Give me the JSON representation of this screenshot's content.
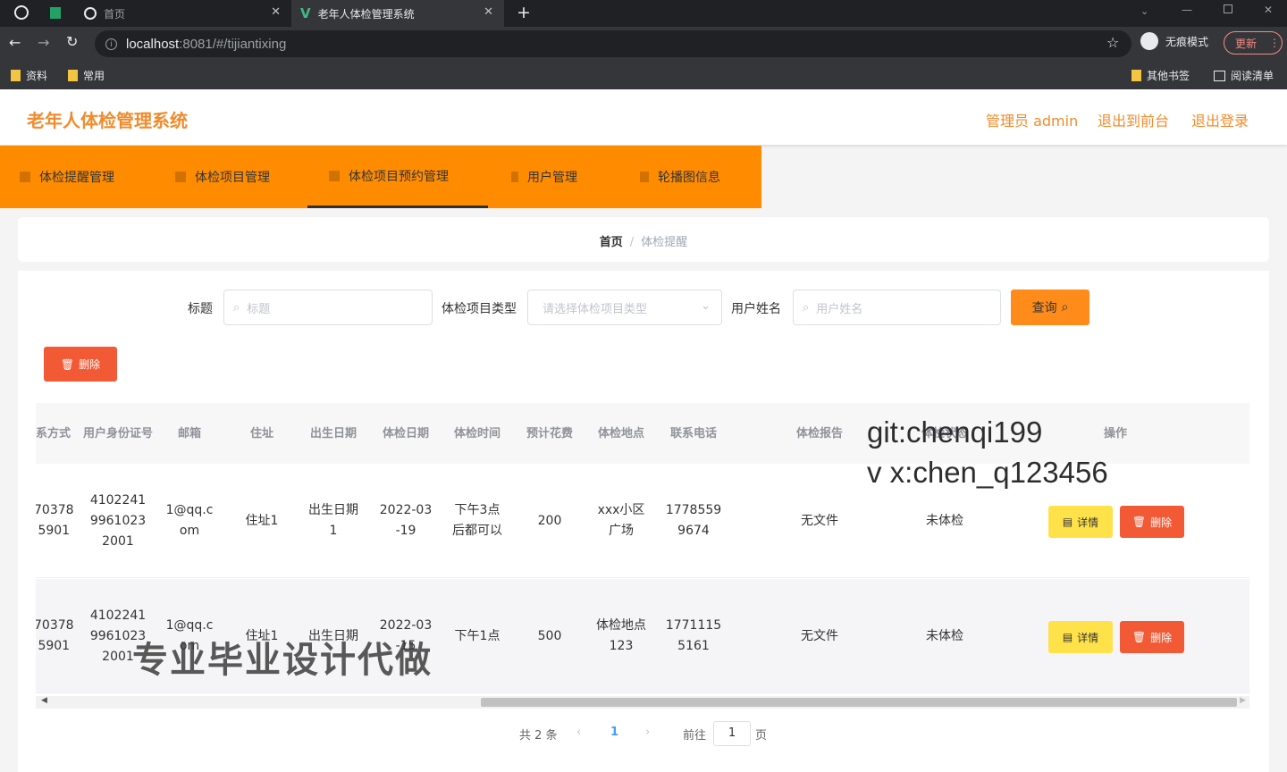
{
  "browser": {
    "tabs": [
      {
        "label": "首页"
      },
      {
        "label": "老年人体检管理系统"
      }
    ],
    "url_host": "localhost",
    "url_path": ":8081/#/tijiantixing",
    "incognito_label": "无痕模式",
    "update_label": "更新",
    "bookmarks": [
      "资料",
      "常用"
    ],
    "other_bookmarks": "其他书签",
    "reading_list": "阅读清单"
  },
  "header": {
    "title": "老年人体检管理系统",
    "admin_label": "管理员 admin",
    "back_label": "退出到前台",
    "logout_label": "退出登录"
  },
  "nav": {
    "items": [
      {
        "label": "体检提醒管理"
      },
      {
        "label": "体检项目管理"
      },
      {
        "label": "体检项目预约管理"
      },
      {
        "label": "用户管理"
      },
      {
        "label": "轮播图信息"
      }
    ]
  },
  "breadcrumb": {
    "home": "首页",
    "sep": "/",
    "current": "体检提醒"
  },
  "search": {
    "title_label": "标题",
    "title_placeholder": "标题",
    "type_label": "体检项目类型",
    "type_placeholder": "请选择体检项目类型",
    "user_label": "用户姓名",
    "user_placeholder": "用户姓名",
    "query_label": "查询"
  },
  "actions": {
    "delete_label": "删除"
  },
  "table": {
    "headers": [
      "系方式",
      "用户身份证号",
      "邮箱",
      "住址",
      "出生日期",
      "体检日期",
      "体检时间",
      "预计花费",
      "体检地点",
      "联系电话",
      "体检报告",
      "体检状态",
      "操作"
    ],
    "rows": [
      {
        "phone": "70378\n5901",
        "idcard": "4102241\n9961023\n2001",
        "email": "1@qq.c\nom",
        "address": "住址1",
        "birth": "出生日期\n1",
        "date": "2022-03\n-19",
        "time": "下午3点\n后都可以",
        "cost": "200",
        "place": "xxx小区\n广场",
        "tel": "1778559\n9674",
        "report": "无文件",
        "status": "未体检",
        "detail": "详情",
        "del": "删除"
      },
      {
        "phone": "70378\n5901",
        "idcard": "4102241\n9961023\n2001",
        "email": "1@qq.c\nom",
        "address": "住址1",
        "birth": "出生日期\n",
        "date": "2022-03\n-15",
        "time": "下午1点",
        "cost": "500",
        "place": "体检地点\n123",
        "tel": "1771115\n5161",
        "report": "无文件",
        "status": "未体检",
        "detail": "详情",
        "del": "删除"
      }
    ]
  },
  "pagination": {
    "total": "共 2 条",
    "current": "1",
    "goto": "前往",
    "page_value": "1",
    "page_suffix": "页"
  },
  "watermarks": {
    "line1": "git:chenqi199",
    "line2": "v x:chen_q123456",
    "cn": "专业毕业设计代做"
  }
}
